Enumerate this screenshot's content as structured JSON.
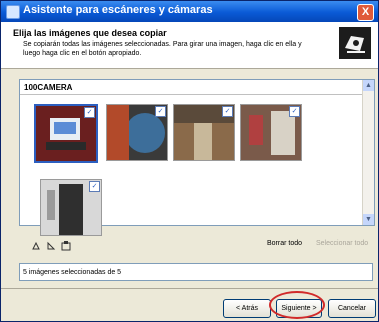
{
  "window": {
    "title": "Asistente para escáneres y cámaras",
    "close_label": "X"
  },
  "header": {
    "title": "Elija las imágenes que desea copiar",
    "description": "Se copiarán todas las imágenes seleccionadas. Para girar una imagen, haga clic en ella y luego haga clic en el botón apropiado."
  },
  "listview": {
    "folder": "100CAMERA",
    "scroll_up": "▲",
    "scroll_down": "▼",
    "check_mark": "✓"
  },
  "actions": {
    "clear_all": "Borrar todo",
    "select_all": "Seleccionar todo"
  },
  "status": {
    "text": "5 imágenes seleccionadas de 5"
  },
  "buttons": {
    "back": "< Atrás",
    "next": "Siguiente >",
    "cancel": "Cancelar"
  },
  "colors": {
    "titlebar": "#0a5ad6",
    "dialog": "#ece9d8",
    "highlight_circle": "#d12a2a"
  }
}
